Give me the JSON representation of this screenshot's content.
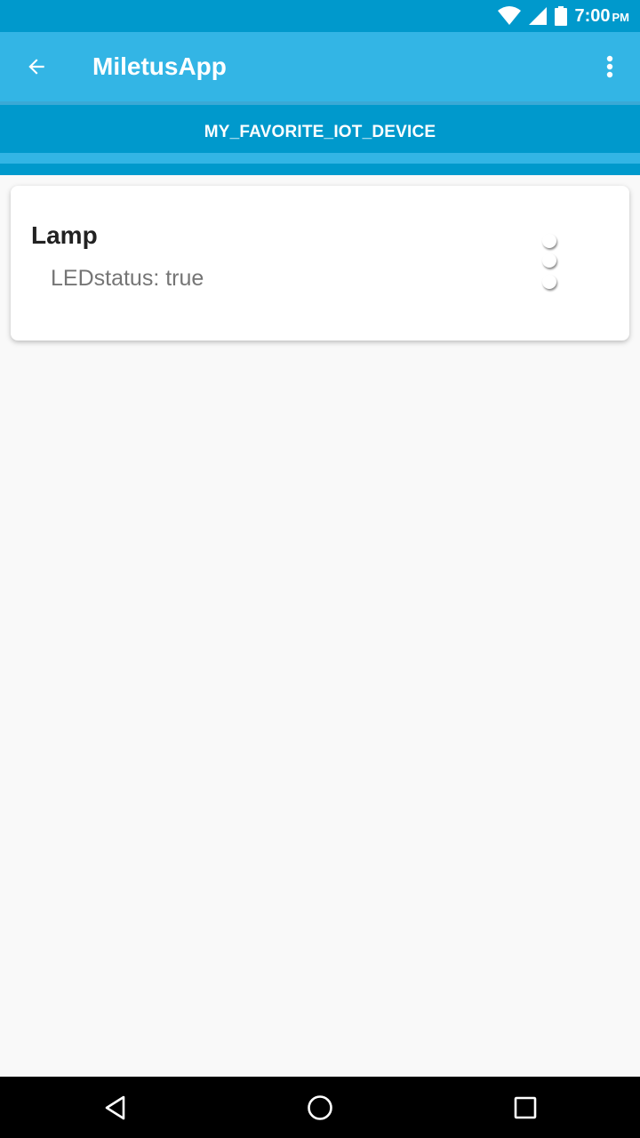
{
  "status_bar": {
    "time": "7:00",
    "ampm": "PM",
    "icons": [
      "wifi-icon",
      "cellular-signal-icon",
      "battery-icon"
    ]
  },
  "app_bar": {
    "title": "MiletusApp",
    "back_icon": "arrow-back-icon",
    "menu_icon": "more-vert-icon"
  },
  "tabs": {
    "active_label": "MY_FAVORITE_IOT_DEVICE"
  },
  "devices": [
    {
      "name": "Lamp",
      "property": "LEDstatus: true",
      "state_icon": "loading-spinner-icon"
    }
  ],
  "nav_bar": {
    "icons": [
      "back-triangle-icon",
      "home-circle-icon",
      "recents-square-icon"
    ]
  },
  "colors": {
    "status_bar": "#0099cc",
    "app_bar": "#33b5e5",
    "tab_strip": "#0099cc",
    "tab_indicator": "#33b5e5",
    "background": "#f9f9f9"
  }
}
